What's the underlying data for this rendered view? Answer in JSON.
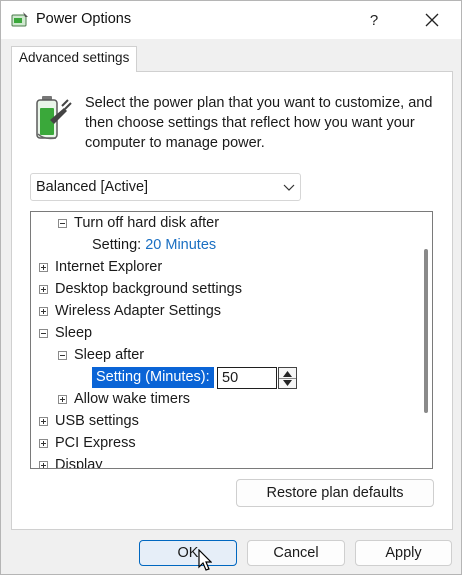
{
  "window": {
    "title": "Power Options",
    "help_label": "?"
  },
  "tab": {
    "label": "Advanced settings"
  },
  "description": "Select the power plan that you want to customize, and then choose settings that reflect how you want your computer to manage power.",
  "plan_select": {
    "value": "Balanced [Active]"
  },
  "tree": {
    "rows": [
      {
        "label": "Turn off hard disk after",
        "toggle": "minus"
      },
      {
        "setting_label": "Setting:",
        "setting_value": "20 Minutes"
      },
      {
        "label": "Internet Explorer",
        "toggle": "plus"
      },
      {
        "label": "Desktop background settings",
        "toggle": "plus"
      },
      {
        "label": "Wireless Adapter Settings",
        "toggle": "plus"
      },
      {
        "label": "Sleep",
        "toggle": "minus"
      },
      {
        "label": "Sleep after",
        "toggle": "minus"
      },
      {
        "edit_label": "Setting (Minutes):",
        "edit_value": "50"
      },
      {
        "label": "Allow wake timers",
        "toggle": "plus"
      },
      {
        "label": "USB settings",
        "toggle": "plus"
      },
      {
        "label": "PCI Express",
        "toggle": "plus"
      },
      {
        "label": "Display",
        "toggle": "plus"
      }
    ]
  },
  "buttons": {
    "restore": "Restore plan defaults",
    "ok": "OK",
    "cancel": "Cancel",
    "apply": "Apply"
  },
  "colors": {
    "accent": "#0a64d6",
    "setting_value": "#1a6fc2",
    "battery_green": "#3aa83a"
  }
}
